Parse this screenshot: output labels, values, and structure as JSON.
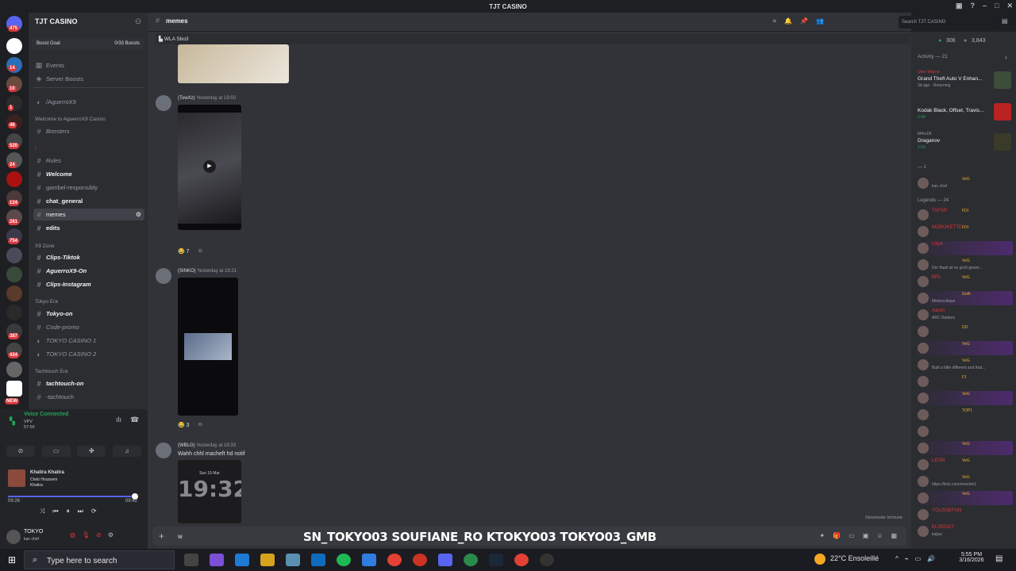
{
  "window": {
    "title": "TJT CASINO"
  },
  "server": {
    "name": "TJT CASINO",
    "boost_goal_label": "Boost Goal",
    "boost_goal_progress": "0/33 Boosts"
  },
  "server_rail": {
    "badges": [
      "475",
      "14",
      "10",
      "1",
      "48",
      "520",
      "24",
      "124",
      "281",
      "754",
      "387",
      "424",
      "NEW"
    ]
  },
  "sidebar": {
    "top_links": [
      "Events",
      "Server Boosts"
    ],
    "channels": [
      {
        "label": "/AguerroX9"
      },
      {
        "category": "Welcome to AguerroX9 Casino"
      },
      {
        "label": "Boosters"
      },
      {
        "category": "!"
      },
      {
        "label": "Rules"
      },
      {
        "label": "Welcome"
      },
      {
        "label": "gambel-responsibly"
      },
      {
        "label": "chat_general"
      },
      {
        "label": "memes"
      },
      {
        "label": "edits"
      },
      {
        "category": "X9 Zone"
      },
      {
        "label": "Clips-Tiktok"
      },
      {
        "label": "AguerroX9-On"
      },
      {
        "label": "Clips-Instagram"
      },
      {
        "category": "Tokyo Era"
      },
      {
        "label": "Tokyo-on"
      },
      {
        "label": "Code-promo"
      },
      {
        "label": "TOKYO CASINO 1"
      },
      {
        "label": "TOKYO CASINO 2"
      },
      {
        "category": "Tachtouch Era"
      },
      {
        "label": "tachtouch-on"
      },
      {
        "label": "-tachtouch"
      }
    ]
  },
  "voice": {
    "status": "Voice Connected",
    "channel": "VPV",
    "elapsed": "57:56"
  },
  "player": {
    "title": "Khatira Khatira",
    "artist": "Cheb Houssem",
    "album": "Khatira",
    "current": "09:26",
    "total": "09:42",
    "progress": 0.97
  },
  "user": {
    "name": "TOKYO",
    "status": "kan chof"
  },
  "channel_header": {
    "name": "memes",
    "search_placeholder": "Search TJT CASINO"
  },
  "thread_bar": {
    "label": "WLA Sbo3"
  },
  "messages": [
    {
      "author": "(TowXz)",
      "time": "Yesterday at 19:50",
      "text": "",
      "reaction_count": "7"
    },
    {
      "author": "(SINKO)",
      "time": "Yesterday at 19:21",
      "text": "",
      "reaction_count": "3"
    },
    {
      "author": "(WBLG)",
      "time": "Yesterday at 19:33",
      "text": "Wahh chhl macheft hd notif",
      "video_time": "19:32",
      "video_date": "Sun 15 Mar"
    }
  ],
  "composer": {
    "value": "w",
    "socials": "SN_TOKYO03  SOUFIANE_RO  KTOKYO03  TOKYO03_GMB"
  },
  "slowmode_label": "Slowmode Immune",
  "members": {
    "online": "306",
    "total": "3,843",
    "activity_label": "Activity — 21",
    "activities": [
      {
        "tag": "Uber Wayne",
        "title": "Grand Theft Auto V Enhan...",
        "status": "3d ago · Returning"
      },
      {
        "tag": "",
        "title": "Kodak Black, Offset, Travis...",
        "status": "2:49"
      },
      {
        "tag": "M4rv1N",
        "title": "Draganov",
        "status": "1:16"
      }
    ],
    "groups": [
      {
        "label": "— 1"
      },
      {
        "label": "Legends — 24"
      }
    ],
    "list": [
      {
        "name": "",
        "tag": "VeG",
        "sub": "kan chof"
      },
      {
        "name": "TAFSR",
        "tag": "FDI",
        "sub": ""
      },
      {
        "name": "MOROKETTE",
        "tag": "FDI",
        "sub": ""
      },
      {
        "name": "Uzy4",
        "tag": "",
        "sub": ""
      },
      {
        "name": "",
        "tag": "VeG",
        "sub": "Der Basil ist so groß gewor..."
      },
      {
        "name": "BRL",
        "tag": "VeG",
        "sub": ""
      },
      {
        "name": "",
        "tag": "Goth",
        "sub": "Melancolique"
      },
      {
        "name": "Aaron",
        "tag": "",
        "sub": "ARC Raiders"
      },
      {
        "name": "",
        "tag": "DD",
        "sub": ""
      },
      {
        "name": "",
        "tag": "VeG",
        "sub": ""
      },
      {
        "name": "",
        "tag": "VeG",
        "sub": "Built a little different and that..."
      },
      {
        "name": "",
        "tag": "F1",
        "sub": ""
      },
      {
        "name": "",
        "tag": "VeG",
        "sub": ""
      },
      {
        "name": "",
        "tag": "TOP1",
        "sub": ""
      },
      {
        "name": "",
        "tag": "",
        "sub": ""
      },
      {
        "name": "",
        "tag": "VeG",
        "sub": ""
      },
      {
        "name": "LEON",
        "tag": "VeG",
        "sub": ""
      },
      {
        "name": "",
        "tag": "VeG",
        "sub": "https://kick.com/smooke1"
      },
      {
        "name": "",
        "tag": "VeG",
        "sub": ""
      },
      {
        "name": "YOUSSEFNN",
        "tag": "",
        "sub": ""
      },
      {
        "name": "ELSEDOT",
        "tag": "",
        "sub": "kaljas"
      }
    ]
  },
  "taskbar": {
    "search_placeholder": "Type here to search",
    "weather": "22°C  Ensoleillé",
    "time": "5:55 PM",
    "date": "3/16/2026"
  },
  "colors": {
    "accent": "#5865f2",
    "danger": "#da373c",
    "online": "#23a55a"
  }
}
